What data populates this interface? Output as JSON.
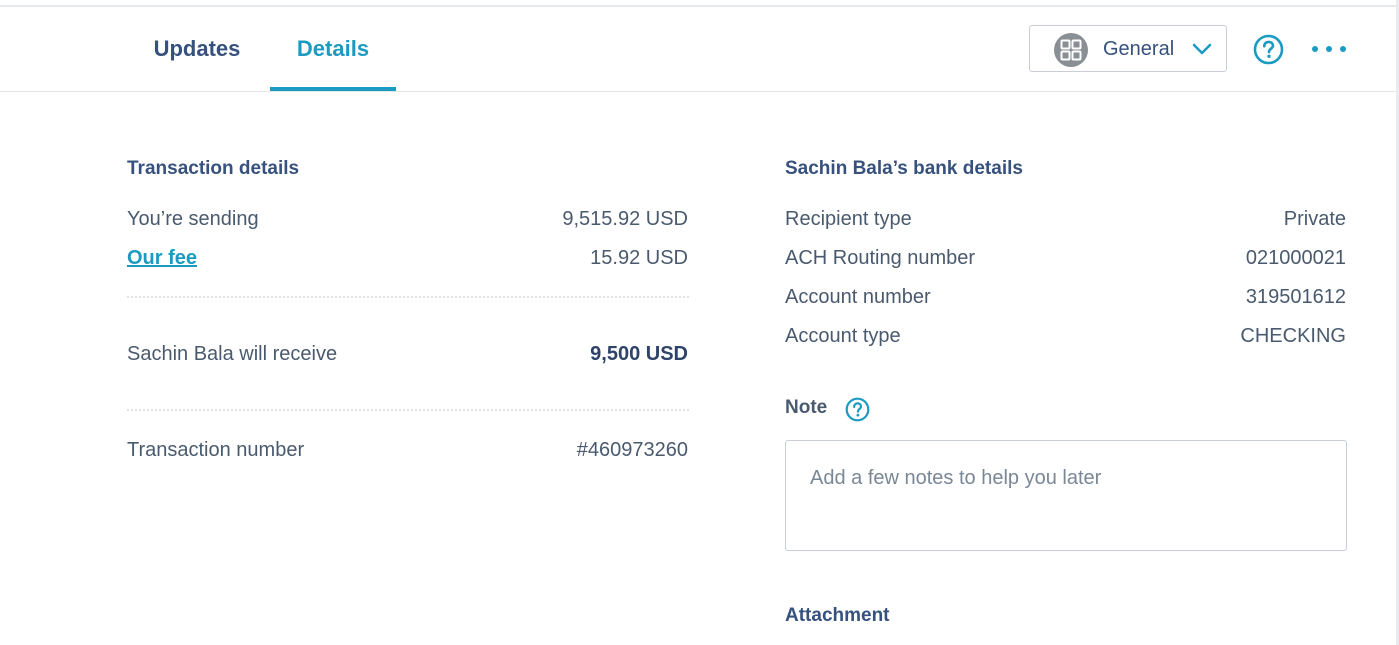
{
  "header": {
    "tabs": [
      {
        "label": "Updates",
        "active": false
      },
      {
        "label": "Details",
        "active": true
      }
    ],
    "profile_select": {
      "selected": "General",
      "icon": "grid-icon"
    },
    "help_icon": "question-circle-icon",
    "more_icon": "ellipsis-icon"
  },
  "transaction": {
    "title": "Transaction details",
    "sending_label": "You’re sending",
    "sending_value": "9,515.92 USD",
    "fee_label": "Our fee",
    "fee_value": "15.92 USD",
    "receive_label": "Sachin Bala will receive",
    "receive_value": "9,500 USD",
    "number_label": "Transaction number",
    "number_value": "#460973260"
  },
  "bank": {
    "title": "Sachin Bala’s bank details",
    "rows": [
      {
        "label": "Recipient type",
        "value": "Private"
      },
      {
        "label": "ACH Routing number",
        "value": "021000021"
      },
      {
        "label": "Account number",
        "value": "319501612"
      },
      {
        "label": "Account type",
        "value": "CHECKING"
      }
    ]
  },
  "note": {
    "label": "Note",
    "placeholder": "Add a few notes to help you later"
  },
  "attachment": {
    "label": "Attachment"
  },
  "colors": {
    "accent": "#1b9bc2",
    "heading": "#37517e",
    "text": "#4a5a6e"
  }
}
